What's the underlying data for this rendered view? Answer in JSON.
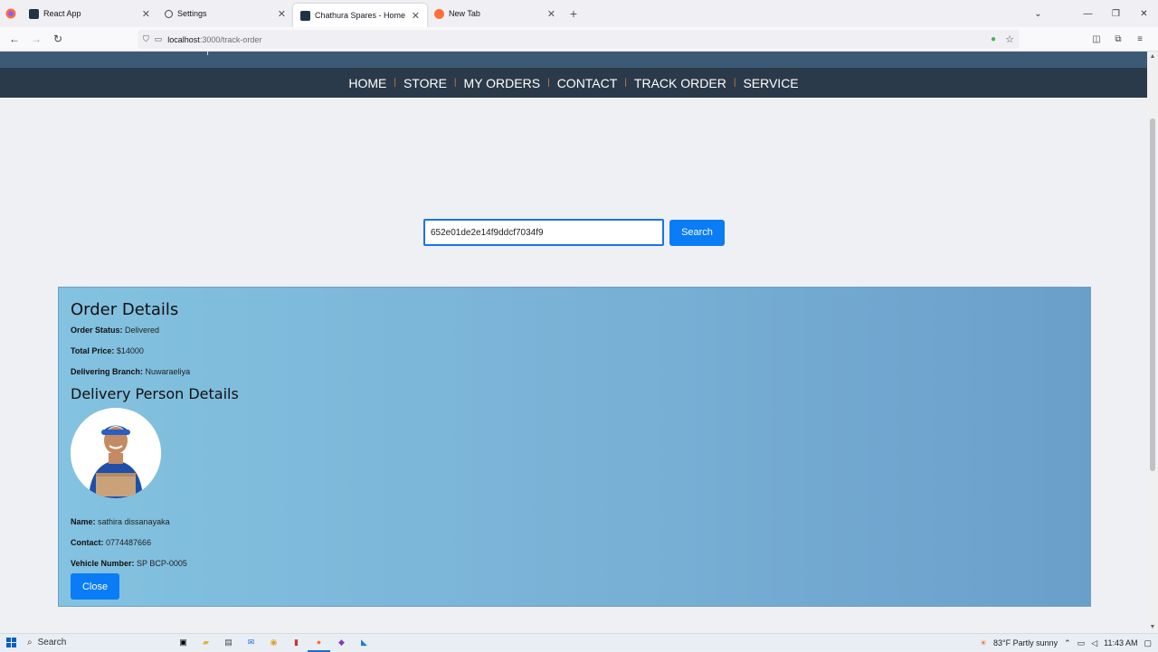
{
  "browser": {
    "tabs": [
      {
        "title": "React App",
        "active": false
      },
      {
        "title": "Settings",
        "active": false
      },
      {
        "title": "Chathura Spares - Home",
        "active": true
      },
      {
        "title": "New Tab",
        "active": false
      }
    ],
    "url_host": "localhost",
    "url_path": ":3000/track-order"
  },
  "nav": {
    "items": [
      "HOME",
      "STORE",
      "MY ORDERS",
      "CONTACT",
      "TRACK ORDER",
      "SERVICE"
    ]
  },
  "search": {
    "value": "652e01de2e14f9ddcf7034f9",
    "button_label": "Search"
  },
  "order": {
    "title": "Order Details",
    "status_label": "Order Status:",
    "status_value": "Delivered",
    "price_label": "Total Price:",
    "price_value": "$14000",
    "branch_label": "Delivering Branch:",
    "branch_value": "Nuwaraeliya"
  },
  "delivery_person": {
    "title": "Delivery Person Details",
    "name_label": "Name:",
    "name_value": "sathira dissanayaka",
    "contact_label": "Contact:",
    "contact_value": "0774487666",
    "vehicle_label": "Vehicle Number:",
    "vehicle_value": "SP BCP-0005",
    "close_label": "Close"
  },
  "taskbar": {
    "search_label": "Search",
    "weather": "83°F  Partly sunny",
    "time": "11:43 AM"
  },
  "colors": {
    "nav_bg": "#2b3a4a",
    "header_bg": "#3c5a75",
    "button_blue": "#0a7cf6",
    "panel_start": "#83c2e0",
    "panel_end": "#6a9fca"
  }
}
